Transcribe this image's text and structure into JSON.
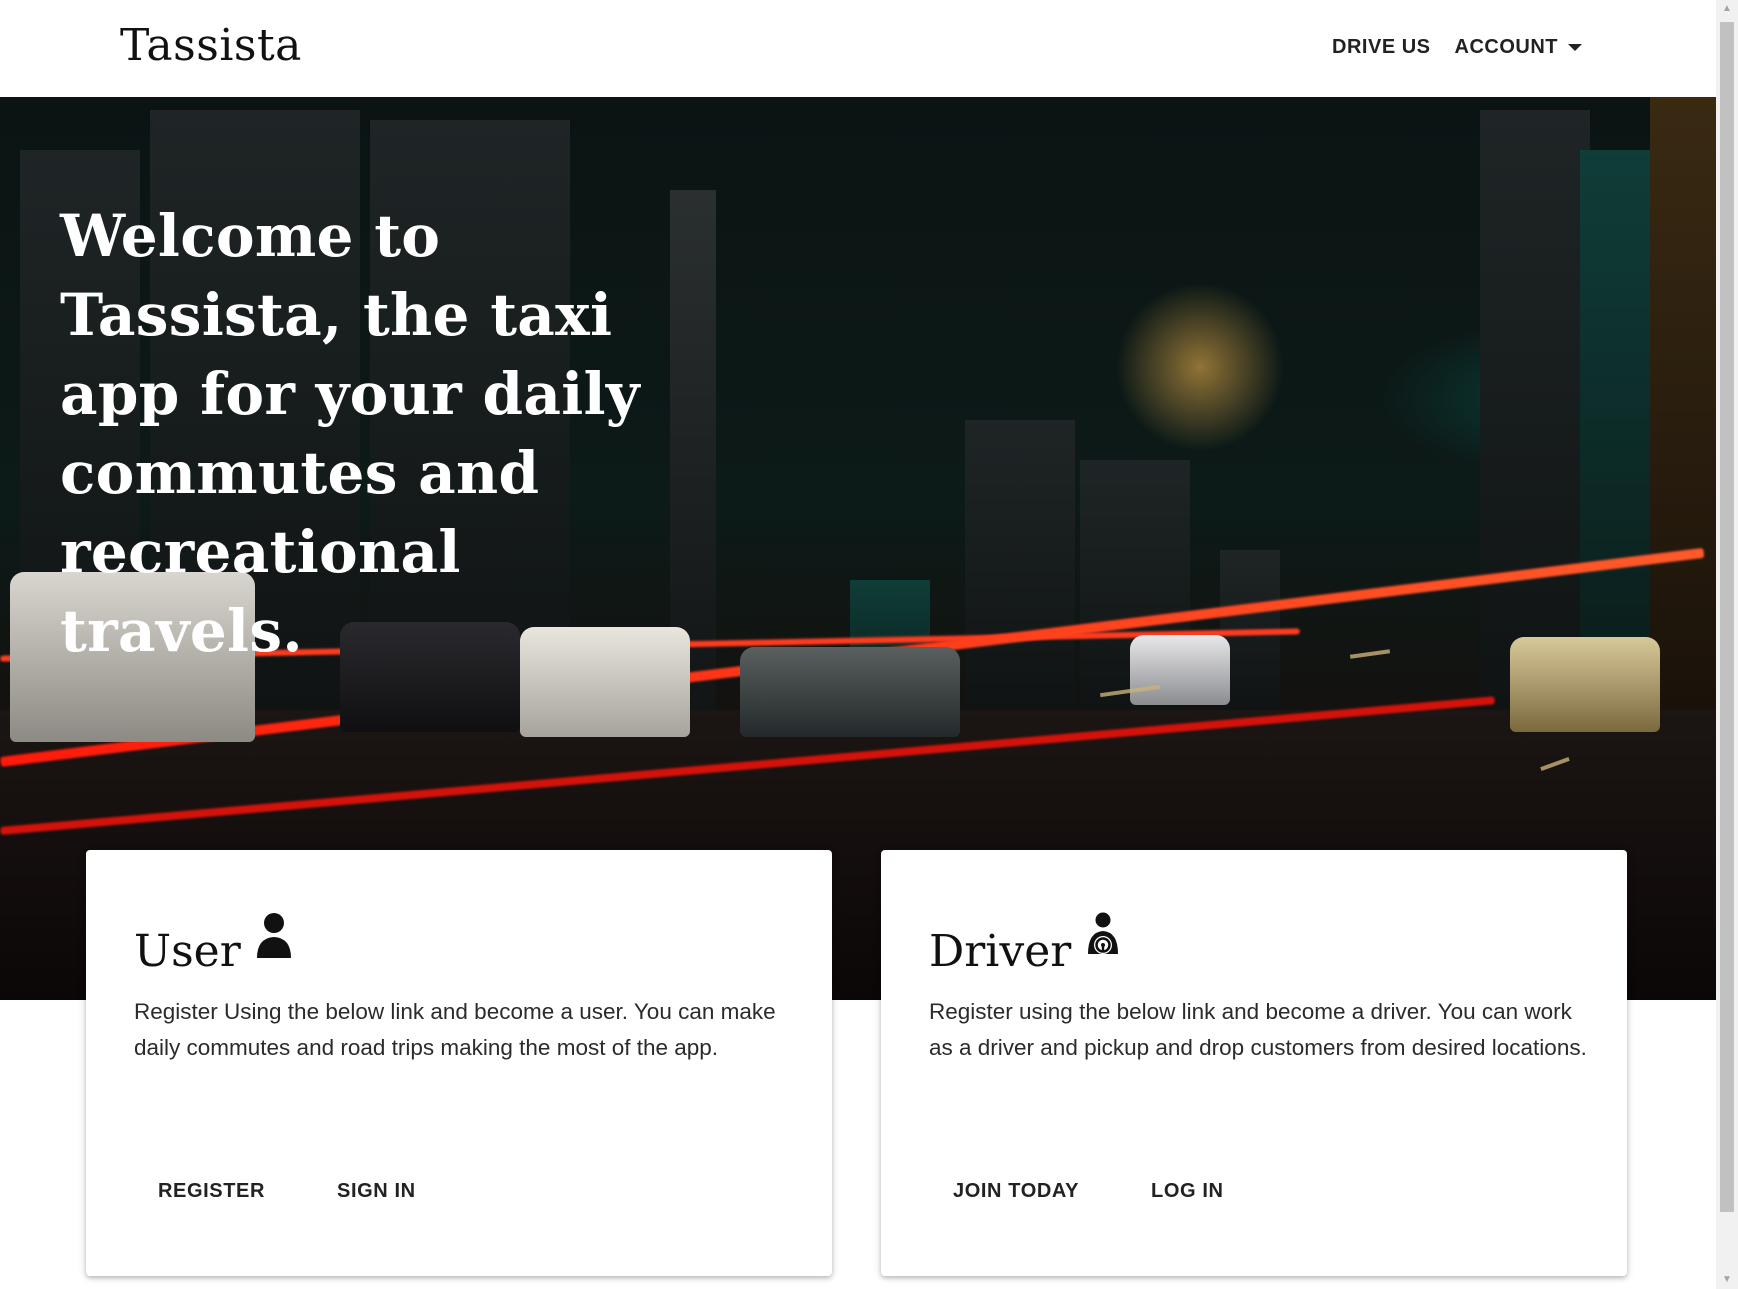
{
  "header": {
    "brand": "Tassista",
    "nav": {
      "drive_us": "DRIVE US",
      "account": "ACCOUNT"
    }
  },
  "hero": {
    "title": "Welcome to Tassista, the taxi app for your daily commutes and recreational travels."
  },
  "cards": {
    "user": {
      "title": "User",
      "icon": "person-icon",
      "text": "Register Using the below link and become a user. You can make daily commutes and road trips making the most of the app.",
      "primary_action": "REGISTER",
      "secondary_action": "SIGN IN"
    },
    "driver": {
      "title": "Driver",
      "icon": "driver-icon",
      "text": "Register using the below link and become a driver. You can work as a driver and pickup and drop customers from desired locations.",
      "primary_action": "JOIN TODAY",
      "secondary_action": "LOG IN"
    }
  },
  "colors": {
    "text": "#212121",
    "hero_text": "#ffffff",
    "card_bg": "#ffffff",
    "streak_red": "#ff2a1a",
    "neon_teal": "#16e0c4"
  }
}
